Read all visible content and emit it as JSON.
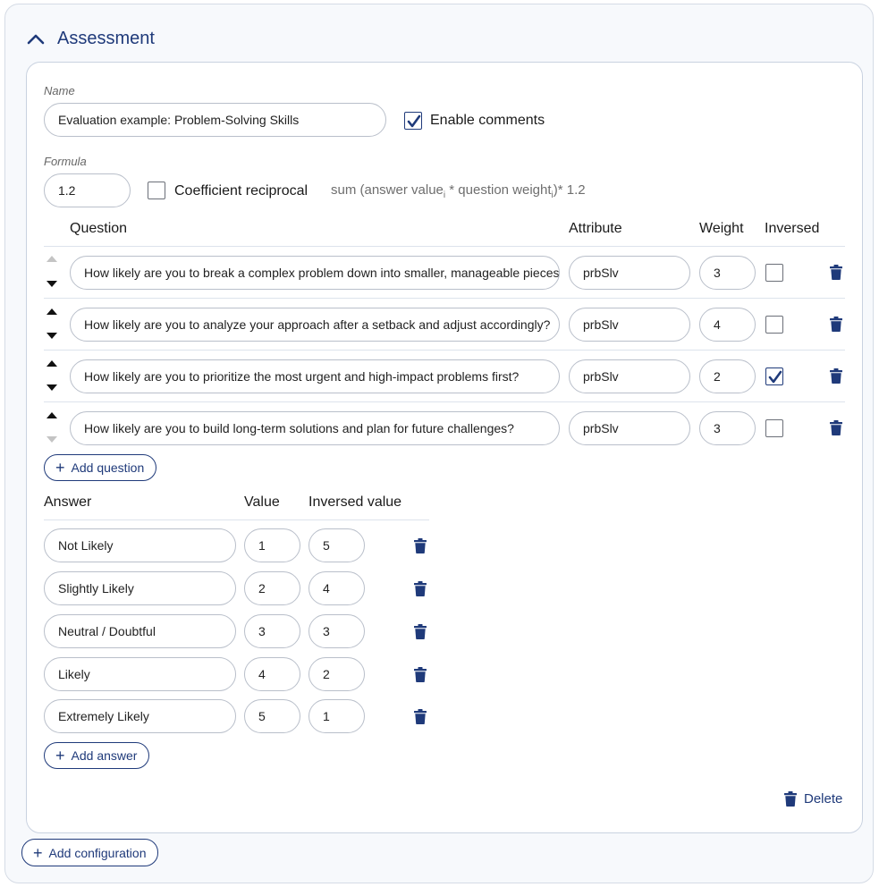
{
  "section": {
    "title": "Assessment"
  },
  "name_label": "Name",
  "name_value": "Evaluation example: Problem-Solving Skills",
  "enable_comments": {
    "label": "Enable comments",
    "checked": true
  },
  "formula_label": "Formula",
  "formula_value": "1.2",
  "coefficient_reciprocal": {
    "label": "Coefficient reciprocal",
    "checked": false
  },
  "formula_expression": {
    "part1": "sum (answer value",
    "sub1": "i",
    "part2": " * question weight",
    "sub2": "i",
    "part3": ")* 1.2"
  },
  "questions_table": {
    "headers": {
      "question": "Question",
      "attribute": "Attribute",
      "weight": "Weight",
      "inversed": "Inversed"
    },
    "rows": [
      {
        "question": "How likely are you to break a complex problem down into smaller, manageable pieces?",
        "attribute": "prbSlv",
        "weight": "3",
        "inversed": false
      },
      {
        "question": "How likely are you to analyze your approach after a setback and adjust accordingly?",
        "attribute": "prbSlv",
        "weight": "4",
        "inversed": false
      },
      {
        "question": "How likely are you to prioritize the most urgent and high-impact problems first?",
        "attribute": "prbSlv",
        "weight": "2",
        "inversed": true
      },
      {
        "question": "How likely are you to build long-term solutions and plan for future challenges?",
        "attribute": "prbSlv",
        "weight": "3",
        "inversed": false
      }
    ]
  },
  "add_question_label": "Add question",
  "answers_table": {
    "headers": {
      "answer": "Answer",
      "value": "Value",
      "inversed_value": "Inversed value"
    },
    "rows": [
      {
        "answer": "Not Likely",
        "value": "1",
        "inversed_value": "5"
      },
      {
        "answer": "Slightly Likely",
        "value": "2",
        "inversed_value": "4"
      },
      {
        "answer": "Neutral / Doubtful",
        "value": "3",
        "inversed_value": "3"
      },
      {
        "answer": "Likely",
        "value": "4",
        "inversed_value": "2"
      },
      {
        "answer": "Extremely Likely",
        "value": "5",
        "inversed_value": "1"
      }
    ]
  },
  "add_answer_label": "Add answer",
  "delete_label": "Delete",
  "add_configuration_label": "Add configuration",
  "colors": {
    "accent": "#1f3a7a",
    "border": "#b9bfca",
    "card_bg": "#f7f9fc"
  }
}
